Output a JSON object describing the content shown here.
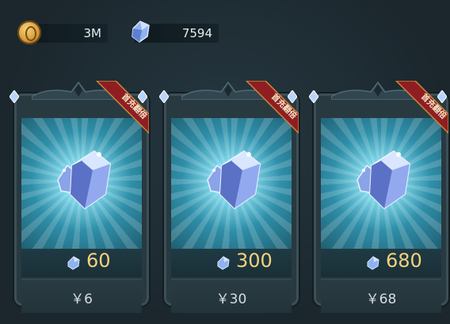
{
  "currency": {
    "gold": {
      "icon": "gold-coin-icon",
      "value": "3M"
    },
    "gems": {
      "icon": "blue-gem-icon",
      "value": "7594"
    }
  },
  "shop": {
    "ribbon_text": "首充翻倍",
    "packs": [
      {
        "amount": "60",
        "price": "￥6"
      },
      {
        "amount": "300",
        "price": "￥30"
      },
      {
        "amount": "680",
        "price": "￥68"
      }
    ]
  },
  "colors": {
    "amount": "#f4d27e",
    "ribbon": "#8f1e22",
    "gem": "#8fb2f0"
  }
}
